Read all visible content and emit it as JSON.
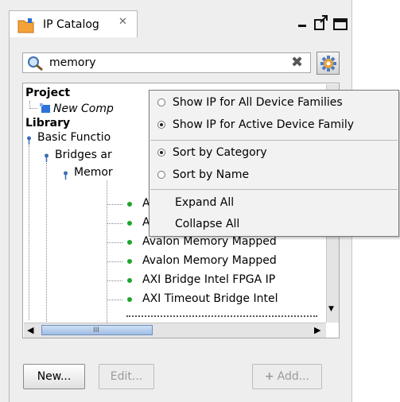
{
  "tab": {
    "title": "IP Catalog",
    "close_glyph": "✕",
    "icon": "folder-icon"
  },
  "window_controls": {
    "minimize": "minimize-icon",
    "maximize": "maximize-icon",
    "restore": "restore-icon"
  },
  "search": {
    "value": "memory",
    "clear_glyph": "✖"
  },
  "tree": {
    "project_header": "Project",
    "project_item": "New Comp",
    "library_header": "Library",
    "basic_functions": "Basic Functio",
    "bridges": "Bridges ar",
    "memory": "Memor",
    "leaf_items": [
      "A",
      "A",
      "Avalon Memory Mapped",
      "Avalon Memory Mapped",
      "AXI Bridge Intel FPGA IP",
      "AXI Timeout Bridge Intel"
    ]
  },
  "scrollbar": {
    "thumb_grip": "III",
    "left_arrow": "◀",
    "right_arrow": "▶",
    "down_arrow": "▼"
  },
  "buttons": {
    "new": "New...",
    "edit": "Edit...",
    "add": "Add...",
    "add_icon": "+"
  },
  "menu": {
    "options_filter": [
      {
        "label": "Show IP for All Device Families",
        "selected": false
      },
      {
        "label": "Show IP for Active Device Family",
        "selected": true
      }
    ],
    "options_sort": [
      {
        "label": "Sort by Category",
        "selected": true
      },
      {
        "label": "Sort by Name",
        "selected": false
      }
    ],
    "expand_all": "Expand All",
    "collapse_all": "Collapse All"
  }
}
